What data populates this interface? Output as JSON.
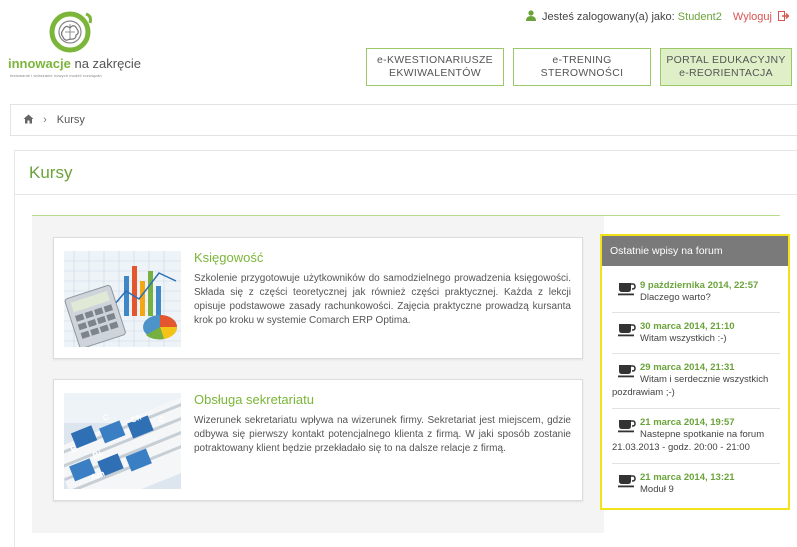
{
  "brand": {
    "name_bold": "innowacje",
    "name_rest": " na zakręcie",
    "tagline": "testowanie i wdrażanie nowych modeli rozwiązań"
  },
  "userbar": {
    "logged_prefix": "Jesteś zalogowany(a) jako:",
    "username": "Student2",
    "logout": "Wyloguj"
  },
  "nav": [
    {
      "line1": "e-KWESTIONARIUSZE",
      "line2": "EKWIWALENTÓW"
    },
    {
      "line1": "e-TRENING",
      "line2": "STEROWNOŚCI"
    },
    {
      "line1": "PORTAL EDUKACYJNY",
      "line2": "e-REORIENTACJA"
    }
  ],
  "breadcrumb": {
    "current": "Kursy"
  },
  "page": {
    "title": "Kursy"
  },
  "courses": [
    {
      "title": "Księgowość",
      "description": "Szkolenie przygotowuje użytkowników do samodzielnego prowadzenia księgowości. Składa się z części teoretycznej jak również części praktycznej. Każda z lekcji opisuje podstawowe zasady rachunkowości. Zajęcia praktyczne prowadzą kursanta krok po kroku w systemie Comarch ERP Optima."
    },
    {
      "title": "Obsługa sekretariatu",
      "description": "Wizerunek sekretariatu wpływa na wizerunek firmy. Sekretariat jest miejscem, gdzie odbywa się pierwszy kontakt potencjalnego klienta z firmą. W jaki sposób zostanie potraktowany klient będzie przekładało się to na dalsze relacje z firmą."
    }
  ],
  "forum": {
    "heading": "Ostatnie wpisy na forum",
    "posts": [
      {
        "date": "9 października 2014, 22:57",
        "text": "Dlaczego warto?"
      },
      {
        "date": "30 marca 2014, 21:10",
        "text": "Witam wszystkich :-)"
      },
      {
        "date": "29 marca 2014, 21:31",
        "text": "Witam i serdecznie wszystkich pozdrawiam ;-)"
      },
      {
        "date": "21 marca 2014, 19:57",
        "text": "Nastepne spotkanie na forum 21.03.2013 - godz. 20:00 - 21:00"
      },
      {
        "date": "21 marca 2014, 13:21",
        "text": "Moduł 9"
      }
    ]
  },
  "colors": {
    "accent": "#7bb63a",
    "highlight": "#f1e21a",
    "logout": "#d9534f"
  }
}
